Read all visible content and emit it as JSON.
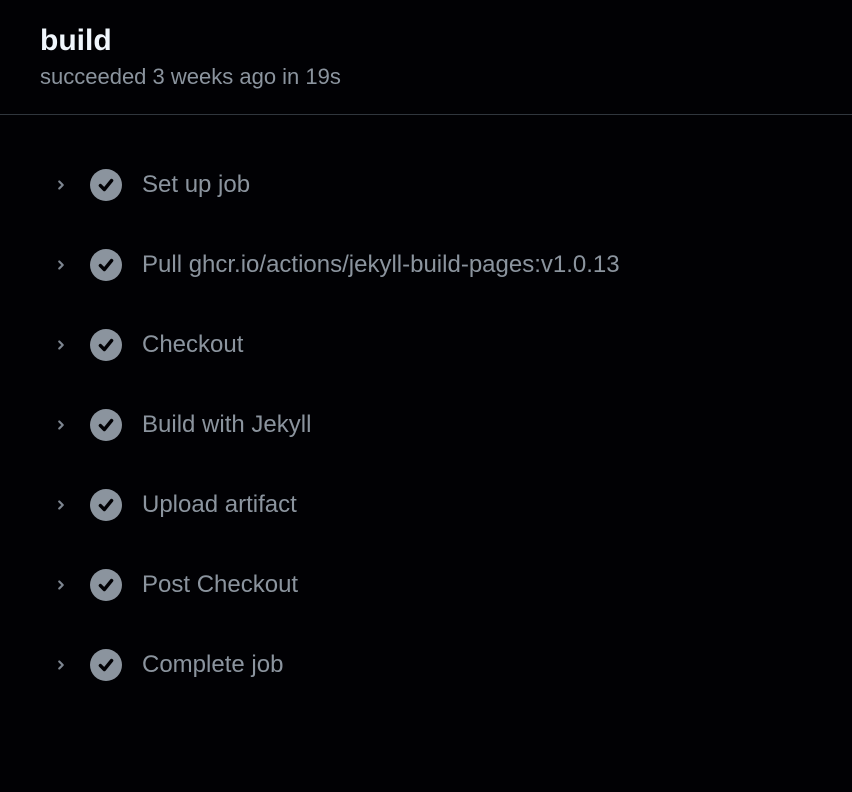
{
  "header": {
    "title": "build",
    "status": "succeeded 3 weeks ago in 19s"
  },
  "steps": [
    {
      "label": "Set up job",
      "status": "success"
    },
    {
      "label": "Pull ghcr.io/actions/jekyll-build-pages:v1.0.13",
      "status": "success"
    },
    {
      "label": "Checkout",
      "status": "success"
    },
    {
      "label": "Build with Jekyll",
      "status": "success"
    },
    {
      "label": "Upload artifact",
      "status": "success"
    },
    {
      "label": "Post Checkout",
      "status": "success"
    },
    {
      "label": "Complete job",
      "status": "success"
    }
  ]
}
